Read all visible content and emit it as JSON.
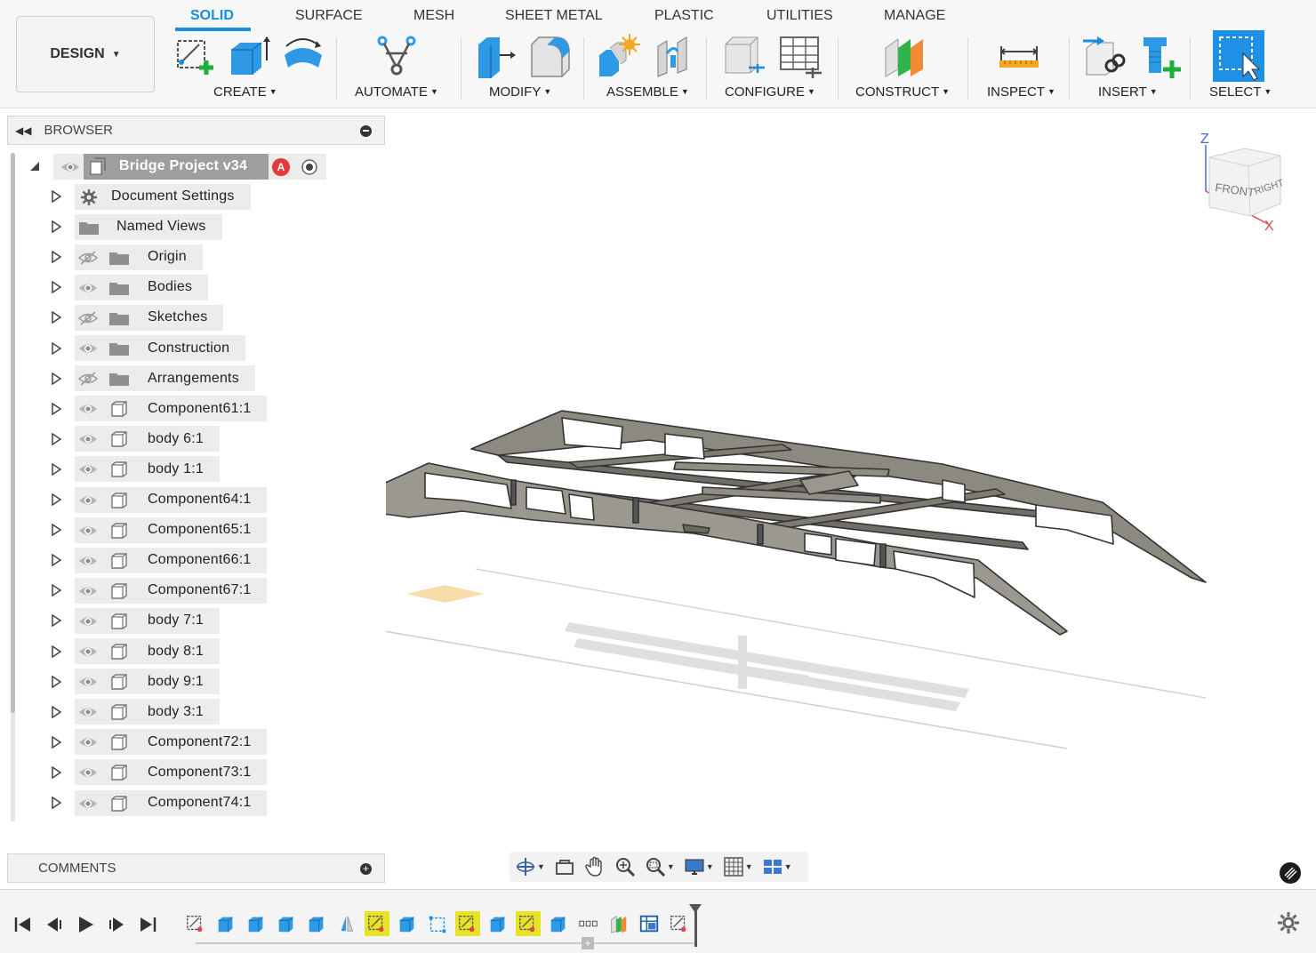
{
  "toolbar": {
    "workspace_button": "DESIGN",
    "tabs": [
      {
        "label": "SOLID",
        "active": true
      },
      {
        "label": "SURFACE"
      },
      {
        "label": "MESH"
      },
      {
        "label": "SHEET METAL"
      },
      {
        "label": "PLASTIC"
      },
      {
        "label": "UTILITIES"
      },
      {
        "label": "MANAGE"
      }
    ],
    "groups": [
      {
        "label": "CREATE"
      },
      {
        "label": "AUTOMATE"
      },
      {
        "label": "MODIFY"
      },
      {
        "label": "ASSEMBLE"
      },
      {
        "label": "CONFIGURE"
      },
      {
        "label": "CONSTRUCT"
      },
      {
        "label": "INSPECT"
      },
      {
        "label": "INSERT"
      },
      {
        "label": "SELECT"
      }
    ],
    "accent_color": "#1a8ce0"
  },
  "browser": {
    "title": "BROWSER",
    "root": {
      "label": "Bridge Project v34",
      "badge": "A"
    },
    "items": [
      {
        "label": "Document Settings",
        "icon": "gear-icon",
        "visibility": "none"
      },
      {
        "label": "Named Views",
        "icon": "folder-icon",
        "visibility": "none"
      },
      {
        "label": "Origin",
        "icon": "folder-icon",
        "visibility": "hidden"
      },
      {
        "label": "Bodies",
        "icon": "folder-icon",
        "visibility": "visible"
      },
      {
        "label": "Sketches",
        "icon": "folder-icon",
        "visibility": "hidden"
      },
      {
        "label": "Construction",
        "icon": "folder-icon",
        "visibility": "visible"
      },
      {
        "label": "Arrangements",
        "icon": "folder-icon",
        "visibility": "hidden"
      },
      {
        "label": "Component61:1",
        "icon": "component-icon",
        "visibility": "visible"
      },
      {
        "label": "body 6:1",
        "icon": "component-icon",
        "visibility": "visible"
      },
      {
        "label": "body 1:1",
        "icon": "component-icon",
        "visibility": "visible"
      },
      {
        "label": "Component64:1",
        "icon": "component-icon",
        "visibility": "visible"
      },
      {
        "label": "Component65:1",
        "icon": "component-icon",
        "visibility": "visible"
      },
      {
        "label": "Component66:1",
        "icon": "component-icon",
        "visibility": "visible"
      },
      {
        "label": "Component67:1",
        "icon": "component-icon",
        "visibility": "visible"
      },
      {
        "label": "body 7:1",
        "icon": "component-icon",
        "visibility": "visible"
      },
      {
        "label": "body 8:1",
        "icon": "component-icon",
        "visibility": "visible"
      },
      {
        "label": "body 9:1",
        "icon": "component-icon",
        "visibility": "visible"
      },
      {
        "label": "body 3:1",
        "icon": "component-icon",
        "visibility": "visible"
      },
      {
        "label": "Component72:1",
        "icon": "component-icon",
        "visibility": "visible"
      },
      {
        "label": "Component73:1",
        "icon": "component-icon",
        "visibility": "visible"
      },
      {
        "label": "Component74:1",
        "icon": "component-icon",
        "visibility": "visible"
      }
    ]
  },
  "comments": {
    "title": "COMMENTS"
  },
  "viewcube": {
    "front": "FRONT",
    "right": "RIGHT",
    "z_axis": "Z",
    "x_axis": "X"
  },
  "timeline": {
    "features": [
      "sketch",
      "extrude",
      "extrude",
      "extrude",
      "extrude",
      "mirror",
      "sketch",
      "extrude",
      "bounding-box",
      "sketch",
      "extrude",
      "sketch",
      "extrude",
      "pattern",
      "joint",
      "table",
      "sketch"
    ],
    "highlighted": [
      6,
      9,
      11
    ]
  }
}
